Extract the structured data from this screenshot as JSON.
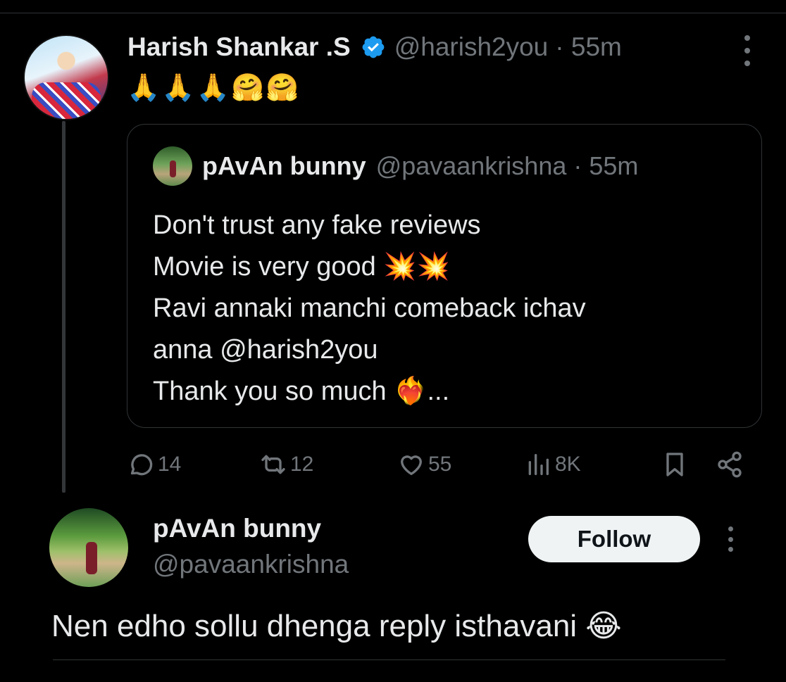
{
  "tweet": {
    "author_name": "Harish Shankar .S",
    "author_handle": "@harish2you",
    "time": "· 55m",
    "text": "🙏🙏🙏🤗🤗",
    "quote": {
      "author_name": "pAvAn bunny",
      "author_handle": "@pavaankrishna",
      "time": "· 55m",
      "lines": [
        "Don't trust any fake reviews",
        "Movie is very good 💥💥",
        "Ravi annaki manchi comeback ichav",
        "anna @harish2you",
        "Thank you so much ❤️‍🔥..."
      ]
    },
    "stats": {
      "replies": "14",
      "reposts": "12",
      "likes": "55",
      "views": "8K"
    }
  },
  "reply": {
    "author_name": "pAvAn bunny",
    "author_handle": "@pavaankrishna",
    "follow_label": "Follow",
    "text": "Nen edho sollu dhenga reply isthavani 😂"
  },
  "colors": {
    "background": "#000000",
    "text_primary": "#e7e9ea",
    "text_secondary": "#71767b",
    "verified_blue": "#1d9bf0",
    "border": "#2f3336"
  }
}
